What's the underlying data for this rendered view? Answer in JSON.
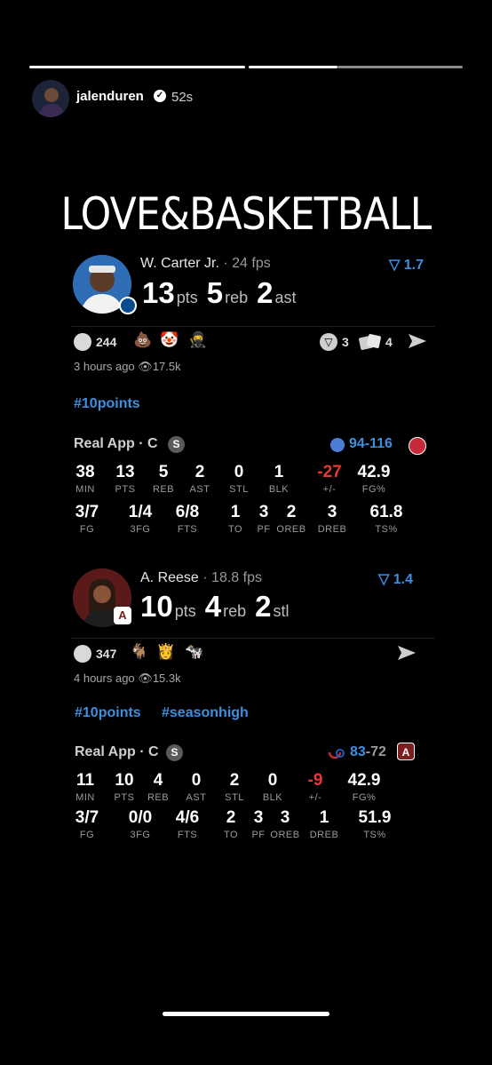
{
  "header": {
    "username": "jalenduren",
    "time": "52s"
  },
  "headline": "LOVE&BASKETBALL",
  "cards": [
    {
      "player_name": "W. Carter Jr.",
      "fps": "· 24 fps",
      "rating": "1.7",
      "big_stats": [
        {
          "value": "13",
          "unit": "pts"
        },
        {
          "value": "5",
          "unit": "reb"
        },
        {
          "value": "2",
          "unit": "ast"
        }
      ],
      "reactions_count": "244",
      "shares": [
        {
          "count": "3"
        },
        {
          "count": "4"
        }
      ],
      "time_ago": "3 hours ago",
      "views": "17.5k",
      "hashtags": [
        "#10points"
      ],
      "app_label": "Real App · C",
      "badge": "S",
      "score_a": "94",
      "score_b": "116",
      "row1": [
        {
          "v": "38",
          "l": "MIN"
        },
        {
          "v": "13",
          "l": "PTS"
        },
        {
          "v": "5",
          "l": "REB"
        },
        {
          "v": "2",
          "l": "AST"
        },
        {
          "v": "0",
          "l": "STL"
        },
        {
          "v": "1",
          "l": "BLK"
        },
        {
          "v": "-27",
          "l": "+/-"
        },
        {
          "v": "42.9",
          "l": "FG%"
        }
      ],
      "row2": [
        {
          "v": "3/7",
          "l": "FG"
        },
        {
          "v": "1/4",
          "l": "3FG"
        },
        {
          "v": "6/8",
          "l": "FTS"
        },
        {
          "v": "1",
          "l": "TO"
        },
        {
          "v": "3",
          "l": "PF"
        },
        {
          "v": "2",
          "l": "OREB"
        },
        {
          "v": "3",
          "l": "DREB"
        },
        {
          "v": "61.8",
          "l": "TS%"
        }
      ]
    },
    {
      "player_name": "A. Reese",
      "fps": "· 18.8 fps",
      "rating": "1.4",
      "big_stats": [
        {
          "value": "10",
          "unit": "pts"
        },
        {
          "value": "4",
          "unit": "reb"
        },
        {
          "value": "2",
          "unit": "stl"
        }
      ],
      "reactions_count": "347",
      "time_ago": "4 hours ago",
      "views": "15.3k",
      "hashtags": [
        "#10points",
        "#seasonhigh"
      ],
      "app_label": "Real App · C",
      "badge": "S",
      "score_a": "83",
      "score_b": "72",
      "row1": [
        {
          "v": "11",
          "l": "MIN"
        },
        {
          "v": "10",
          "l": "PTS"
        },
        {
          "v": "4",
          "l": "REB"
        },
        {
          "v": "0",
          "l": "AST"
        },
        {
          "v": "2",
          "l": "STL"
        },
        {
          "v": "0",
          "l": "BLK"
        },
        {
          "v": "-9",
          "l": "+/-"
        },
        {
          "v": "42.9",
          "l": "FG%"
        }
      ],
      "row2": [
        {
          "v": "3/7",
          "l": "FG"
        },
        {
          "v": "0/0",
          "l": "3FG"
        },
        {
          "v": "4/6",
          "l": "FTS"
        },
        {
          "v": "2",
          "l": "TO"
        },
        {
          "v": "3",
          "l": "PF"
        },
        {
          "v": "3",
          "l": "OREB"
        },
        {
          "v": "1",
          "l": "DREB"
        },
        {
          "v": "51.9",
          "l": "TS%"
        }
      ]
    }
  ],
  "colors": {
    "accent": "#3d8fe0",
    "negative": "#e53935",
    "background": "#000000"
  }
}
